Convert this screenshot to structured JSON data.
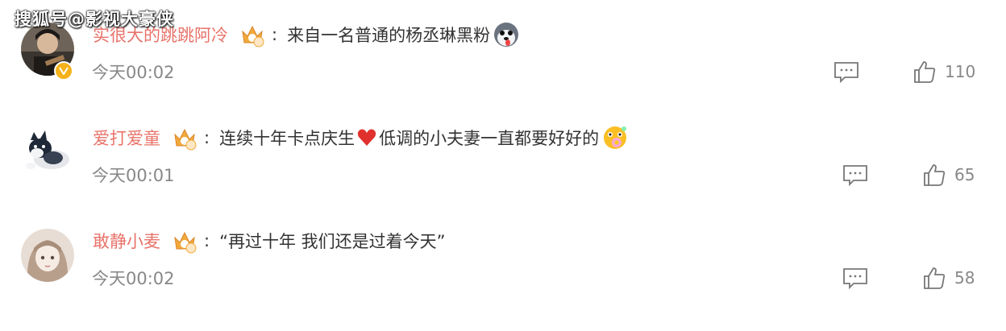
{
  "watermark": "搜狐号@影视大豪侠",
  "comments": [
    {
      "username": "实很大的跳跳阿冷",
      "text": "来自一名普通的杨丞琳黑粉",
      "time": "今天00:02",
      "likes": "110",
      "verified": true,
      "emoji_icon": "husky-emoji-icon"
    },
    {
      "username": "爱打爱童",
      "text_before": "连续十年卡点庆生",
      "text_after": "低调的小夫妻一直都要好好的",
      "time": "今天00:01",
      "likes": "65",
      "verified": false,
      "emoji_icon": "flower-face-emoji-icon"
    },
    {
      "username": "敢静小麦",
      "text": "“再过十年 我们还是过着今天”",
      "time": "今天00:02",
      "likes": "58",
      "verified": false
    }
  ],
  "colors": {
    "username": "#e8736a",
    "time": "#888888",
    "text": "#333333",
    "heart": "#e0312c",
    "crown": "#f2a93b"
  }
}
